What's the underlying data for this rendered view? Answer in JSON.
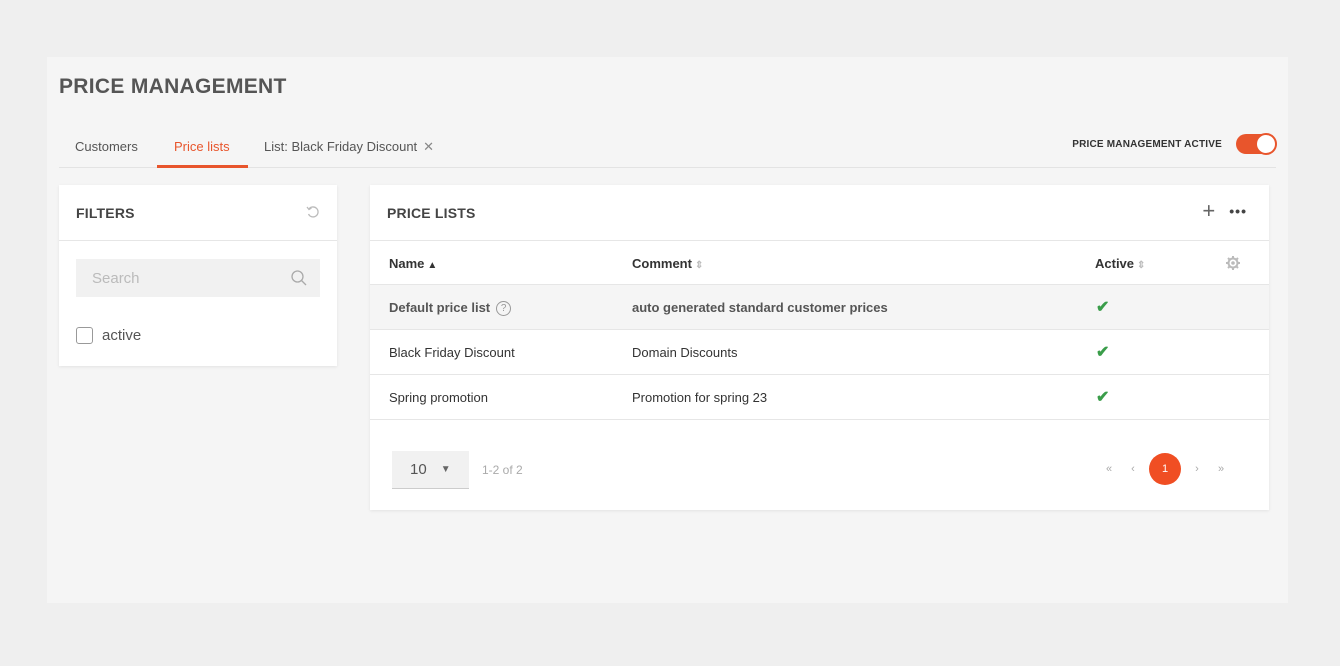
{
  "page": {
    "title": "PRICE MANAGEMENT"
  },
  "tabs": [
    {
      "label": "Customers"
    },
    {
      "label": "Price lists"
    },
    {
      "label": "List: Black Friday Discount"
    }
  ],
  "price_management_toggle": {
    "label": "PRICE MANAGEMENT ACTIVE",
    "on": true
  },
  "filters": {
    "title": "FILTERS",
    "search_placeholder": "Search",
    "checkbox_label": "active"
  },
  "price_lists": {
    "title": "PRICE LISTS",
    "columns": {
      "name": "Name",
      "comment": "Comment",
      "active": "Active"
    },
    "rows": [
      {
        "name": "Default price list",
        "comment": "auto generated standard customer prices",
        "active": true
      },
      {
        "name": "Black Friday Discount",
        "comment": "Domain Discounts",
        "active": true
      },
      {
        "name": "Spring promotion",
        "comment": "Promotion for spring 23",
        "active": true
      }
    ],
    "pager": {
      "page_size": "10",
      "range": "1-2 of 2",
      "current_page": "1",
      "first": "«",
      "prev": "‹",
      "next": "›",
      "last": "»"
    }
  },
  "colors": {
    "accent": "#e8552c",
    "check": "#3a9d4a"
  }
}
